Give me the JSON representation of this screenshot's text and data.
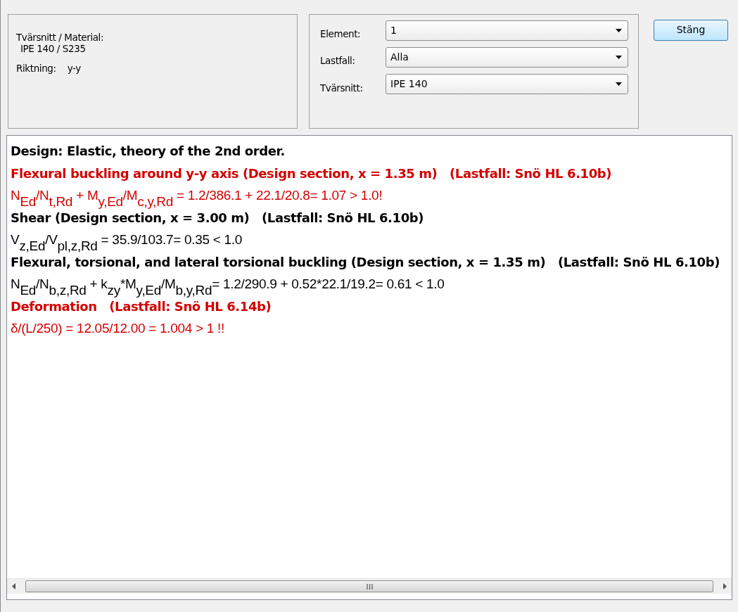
{
  "info_panel": {
    "section_label": "Tvärsnitt / Material:",
    "section_value": "IPE 140 / S235",
    "direction_label": "Riktning:",
    "direction_value": "y-y"
  },
  "selectors": [
    {
      "label": "Element:",
      "value": "1"
    },
    {
      "label": "Lastfall:",
      "value": "Alla"
    },
    {
      "label": "Tvärsnitt:",
      "value": "IPE 140"
    }
  ],
  "close_button": "Stäng",
  "report_lines": [
    {
      "kind": "heading",
      "alert": false,
      "text": "Design: Elastic, theory of the 2nd order."
    },
    {
      "kind": "heading",
      "alert": true,
      "text": "Flexural buckling around y-y axis (Design section, x = 1.35 m)   (Lastfall: Snö HL 6.10b)"
    },
    {
      "kind": "formula",
      "alert": true,
      "text": "N$_{Ed}$/N$_{t,Rd}$ + M$_{y,Ed}$/M$_{c,y,Rd}$ = 1.2/386.1 + 22.1/20.8= 1.07 > 1.0!"
    },
    {
      "kind": "heading",
      "alert": false,
      "text": "Shear (Design section, x = 3.00 m)   (Lastfall: Snö HL 6.10b)"
    },
    {
      "kind": "formula",
      "alert": false,
      "text": "V$_{z,Ed}$/V$_{pl,z,Rd}$ = 35.9/103.7= 0.35 < 1.0"
    },
    {
      "kind": "heading",
      "alert": false,
      "text": "Flexural, torsional, and lateral torsional buckling (Design section, x = 1.35 m)   (Lastfall: Snö HL 6.10b)"
    },
    {
      "kind": "formula",
      "alert": false,
      "text": "N$_{Ed}$/N$_{b,z,Rd}$ + k$_{zy}$*M$_{y,Ed}$/M$_{b,y,Rd}$= 1.2/290.9 + 0.52*22.1/19.2= 0.61 < 1.0"
    },
    {
      "kind": "heading",
      "alert": true,
      "text": "Deformation   (Lastfall: Snö HL 6.14b)"
    },
    {
      "kind": "formula",
      "alert": true,
      "text": "δ/(L/250) = 12.05/12.00 = 1.004 > 1 !!"
    }
  ]
}
